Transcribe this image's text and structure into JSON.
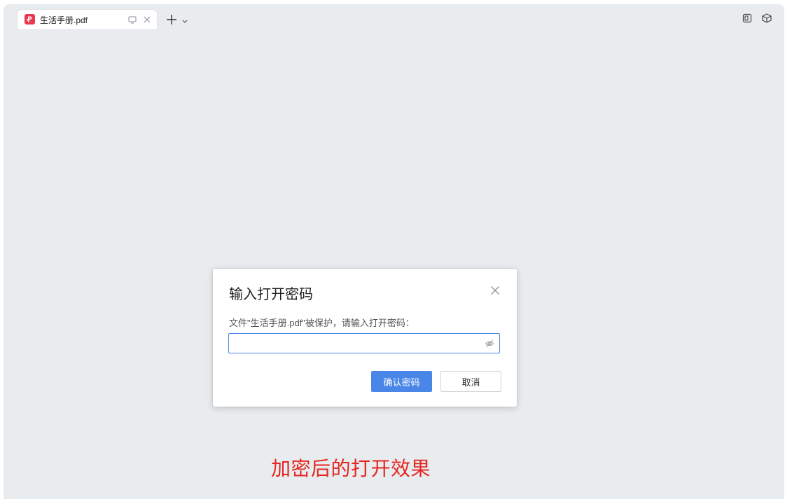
{
  "tab": {
    "title": "生活手册.pdf",
    "app_icon": "pdf-app-icon",
    "monitor_icon": "monitor-icon",
    "close_icon": "close-icon"
  },
  "toolbar": {
    "new_tab_icon": "plus-icon",
    "dropdown_icon": "chevron-down-icon",
    "right_icons": [
      "layout-icon",
      "cube-icon"
    ]
  },
  "dialog": {
    "title": "输入打开密码",
    "message": "文件\"生活手册.pdf\"被保护，请输入打开密码：",
    "password_value": "",
    "password_placeholder": "",
    "confirm_label": "确认密码",
    "cancel_label": "取消"
  },
  "caption": "加密后的打开效果",
  "colors": {
    "accent": "#4a86e8",
    "app_icon": "#e8384f",
    "caption": "#e42620",
    "background": "#e9ecef"
  }
}
